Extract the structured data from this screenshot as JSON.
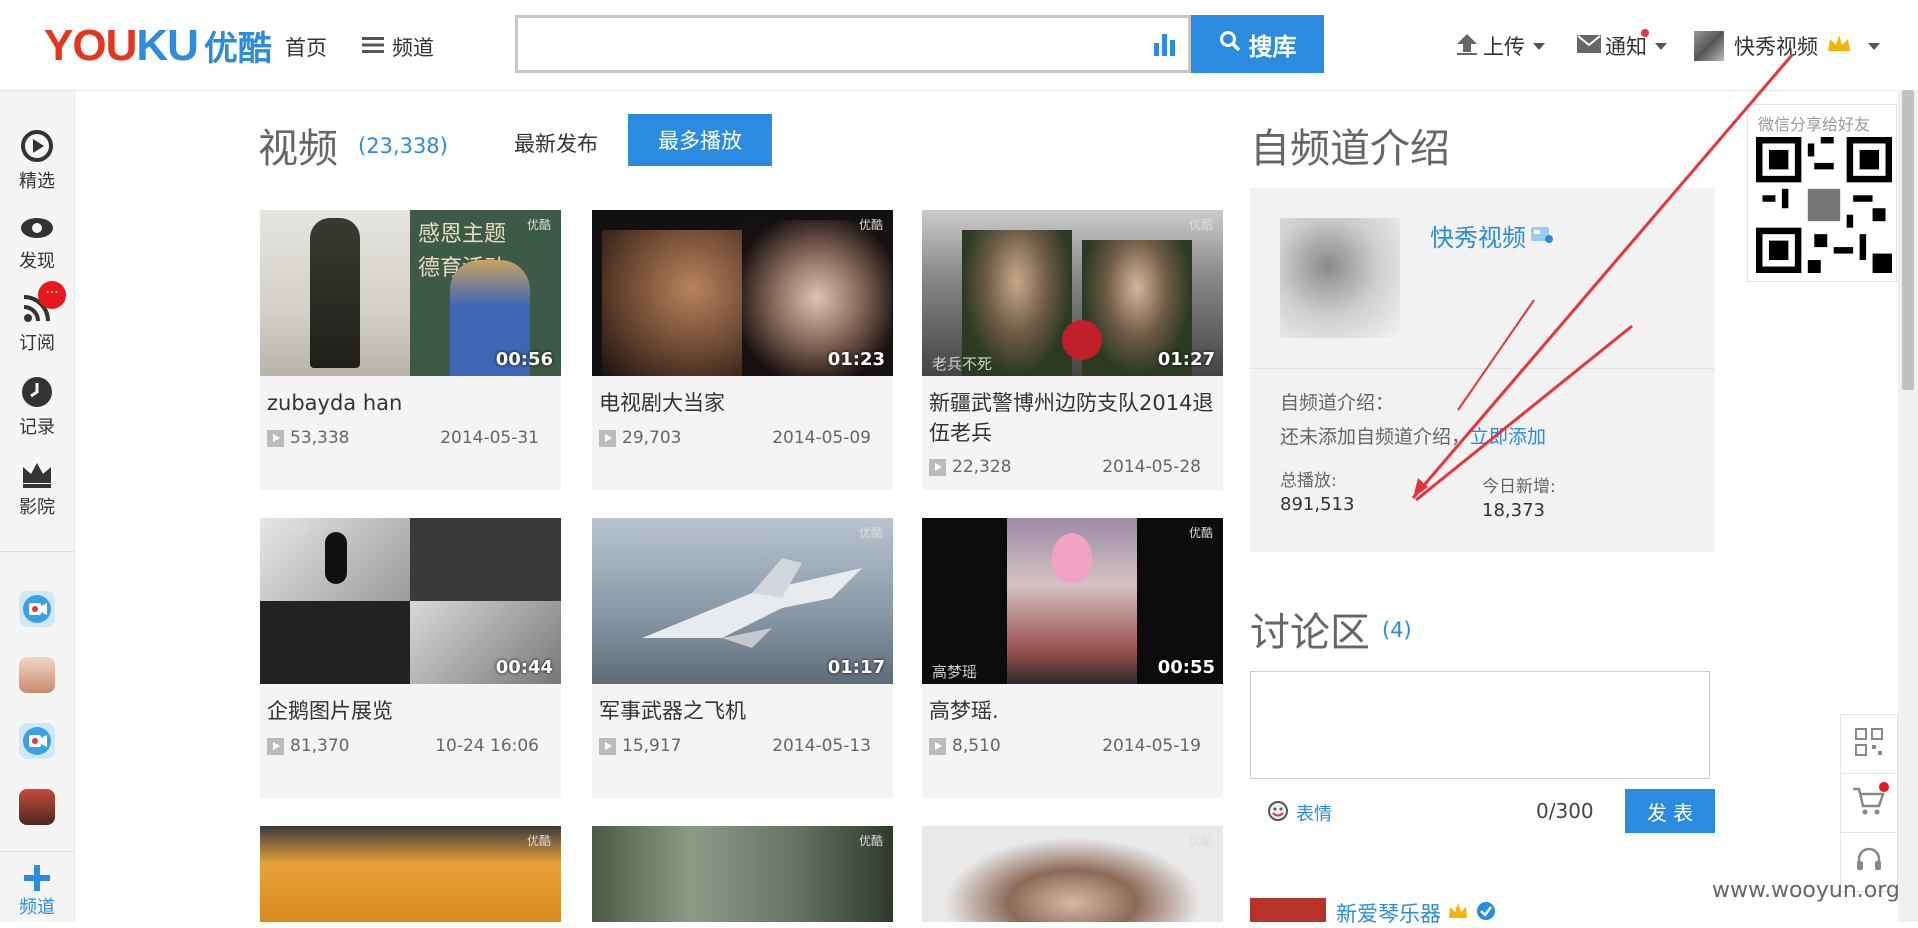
{
  "header": {
    "logo_en_a": "YOU",
    "logo_en_b": "KU",
    "logo_cn": "优酷",
    "nav_home": "首页",
    "nav_channel": "频道",
    "search_value": "",
    "search_button": "搜库",
    "upload": "上传",
    "notify": "通知",
    "user_name": "快秀视频"
  },
  "sidebar": {
    "items": [
      "精选",
      "发现",
      "订阅",
      "记录",
      "影院"
    ],
    "badge": "···",
    "add_label": "频道"
  },
  "videos_section": {
    "title": "视频",
    "count": "(23,338)",
    "tab_latest": "最新发布",
    "tab_most": "最多播放",
    "watermark": "优酷",
    "cards": [
      {
        "title": "zubayda han",
        "plays": "53,338",
        "date": "2014-05-31",
        "duration": "00:56"
      },
      {
        "title": "电视剧大当家",
        "plays": "29,703",
        "date": "2014-05-09",
        "duration": "01:23"
      },
      {
        "title": "新疆武警博州边防支队2014退伍老兵",
        "plays": "22,328",
        "date": "2014-05-28",
        "duration": "01:27"
      },
      {
        "title": "企鹅图片展览",
        "plays": "81,370",
        "date": "10-24 16:06",
        "duration": "00:44"
      },
      {
        "title": "军事武器之飞机",
        "plays": "15,917",
        "date": "2014-05-13",
        "duration": "01:17"
      },
      {
        "title": "高梦瑶.",
        "plays": "8,510",
        "date": "2014-05-19",
        "duration": "00:55"
      }
    ],
    "thumb_text_1a": "感恩主题",
    "thumb_text_1b": "德育活动",
    "thumb_text_3": "老兵不死",
    "thumb_text_6": "高梦瑶"
  },
  "intro_section": {
    "title": "自频道介绍",
    "channel_name": "快秀视频",
    "intro_label": "自频道介绍：",
    "intro_empty": "还未添加自频道介绍，",
    "intro_add_link": "立即添加",
    "total_label": "总播放:",
    "total_value": "891,513",
    "today_label": "今日新增:",
    "today_value": "18,373"
  },
  "qr_panel": {
    "caption": "微信分享给好友"
  },
  "discussion": {
    "title": "讨论区",
    "count": "(4)",
    "emoji_label": "表情",
    "char_count": "0/300",
    "submit": "发  表",
    "first_comment_user": "新爱琴乐器"
  },
  "watermark_site": "www.wooyun.org",
  "colors": {
    "accent_blue": "#2a8be0",
    "logo_red": "#e8341c",
    "arrow_red": "#e8343a"
  }
}
